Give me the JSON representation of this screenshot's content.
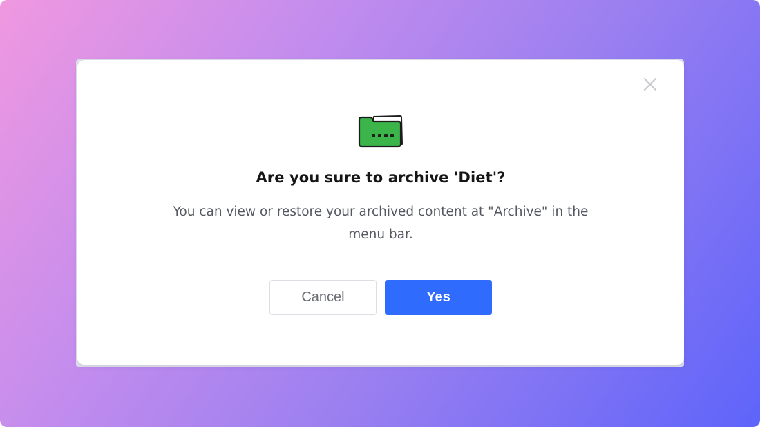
{
  "dialog": {
    "title": "Are you sure to archive 'Diet'?",
    "message": "You can view or restore your archived content at \"Archive\" in the menu bar.",
    "cancel_label": "Cancel",
    "confirm_label": "Yes",
    "close_icon": "close-icon",
    "illustration_icon": "folder-icon"
  },
  "colors": {
    "primary_button": "#2f6bfd",
    "folder_green": "#3bb54a",
    "title_text": "#151515",
    "body_text": "#555761"
  }
}
